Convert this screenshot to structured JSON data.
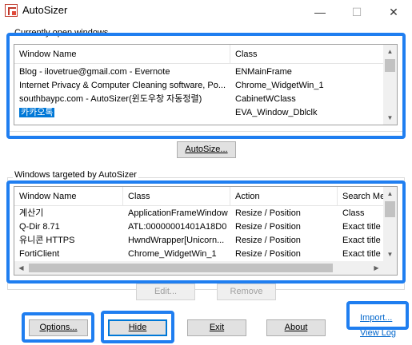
{
  "window": {
    "title": "AutoSizer",
    "min_glyph": "—",
    "max_glyph": "☐",
    "close_glyph": "✕"
  },
  "open_windows": {
    "group_label": "Currently open windows",
    "columns": [
      "Window Name",
      "Class"
    ],
    "rows": [
      {
        "name": "Blog - ilovetrue@gmail.com - Evernote",
        "class": "ENMainFrame"
      },
      {
        "name": "Internet Privacy & Computer Cleaning software, Po...",
        "class": "Chrome_WidgetWin_1"
      },
      {
        "name": "southbaypc.com -  AutoSizer(윈도우창 자동정렬)",
        "class": "CabinetWClass"
      },
      {
        "name": "카카오톡",
        "class": "EVA_Window_Dblclk",
        "selected": true
      }
    ],
    "autosize_button": "AutoSize..."
  },
  "targeted": {
    "group_label": "Windows targeted by AutoSizer",
    "columns": [
      "Window Name",
      "Class",
      "Action",
      "Search Me"
    ],
    "rows": [
      {
        "name": "계산기",
        "class": "ApplicationFrameWindow",
        "action": "Resize / Position",
        "search": "Class"
      },
      {
        "name": "Q-Dir 8.71",
        "class": "ATL:00000001401A18D0",
        "action": "Resize / Position",
        "search": "Exact title"
      },
      {
        "name": "유니콘 HTTPS",
        "class": "HwndWrapper[Unicorn...",
        "action": "Resize / Position",
        "search": "Exact title"
      },
      {
        "name": "FortiClient",
        "class": "Chrome_WidgetWin_1",
        "action": "Resize / Position",
        "search": "Exact title"
      }
    ],
    "edit_button": "Edit...",
    "remove_button": "Remove"
  },
  "bottom": {
    "options_button": "Options...",
    "hide_button": "Hide",
    "exit_button": "Exit",
    "about_button": "About",
    "import_link": "Import...",
    "viewlog_link": "View Log"
  },
  "colors": {
    "highlight": "#1f7ef0",
    "selection": "#0078d7",
    "link": "#0066cc"
  }
}
